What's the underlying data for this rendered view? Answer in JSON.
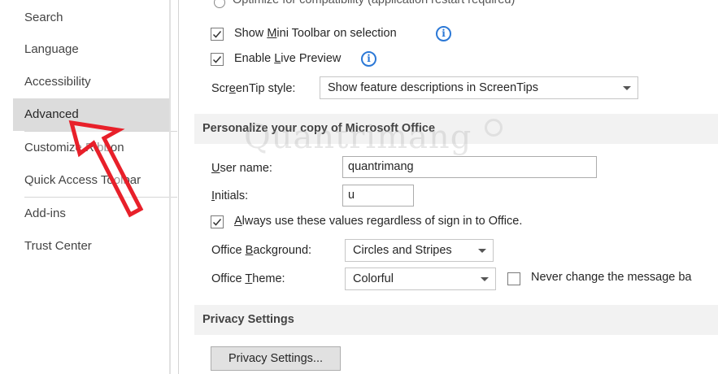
{
  "sidebar": {
    "items": [
      {
        "label": "Search"
      },
      {
        "label": "Language"
      },
      {
        "label": "Accessibility"
      },
      {
        "label": "Advanced",
        "selected": true
      },
      {
        "label": "Customize Ribbon"
      },
      {
        "label": "Quick Access Toolbar"
      },
      {
        "label": "Add-ins"
      },
      {
        "label": "Trust Center"
      }
    ]
  },
  "ui_options": {
    "optimize_compat": {
      "label": "Optimize for compatibility (application restart required)"
    },
    "mini_toolbar": {
      "pre": "Show ",
      "key": "M",
      "post": "ini Toolbar on selection",
      "checked": true
    },
    "live_preview": {
      "pre": "Enable ",
      "key": "L",
      "post": "ive Preview",
      "checked": true
    },
    "screentip": {
      "pre": "Scr",
      "key": "e",
      "post": "enTip style:",
      "value": "Show feature descriptions in ScreenTips"
    }
  },
  "personalize": {
    "header": "Personalize your copy of Microsoft Office",
    "user_name": {
      "key": "U",
      "post": "ser name:",
      "value": "quantrimang"
    },
    "initials": {
      "key": "I",
      "post": "nitials:",
      "value": "u"
    },
    "always_use": {
      "key": "A",
      "post": "lways use these values regardless of sign in to Office.",
      "checked": true
    },
    "office_background": {
      "pre": "Office ",
      "key": "B",
      "post": "ackground:",
      "value": "Circles and Stripes"
    },
    "office_theme": {
      "pre": "Office ",
      "key": "T",
      "post": "heme:",
      "value": "Colorful"
    },
    "never_change": {
      "label": "Never change the message ba",
      "checked": false
    }
  },
  "privacy": {
    "header": "Privacy Settings",
    "button_label": "Privacy Settings..."
  },
  "watermark": {
    "text": "Quantrimang"
  },
  "colors": {
    "accent": "#2b78d6",
    "arrow": "#e8202a",
    "selected": "#dcdcdc"
  }
}
